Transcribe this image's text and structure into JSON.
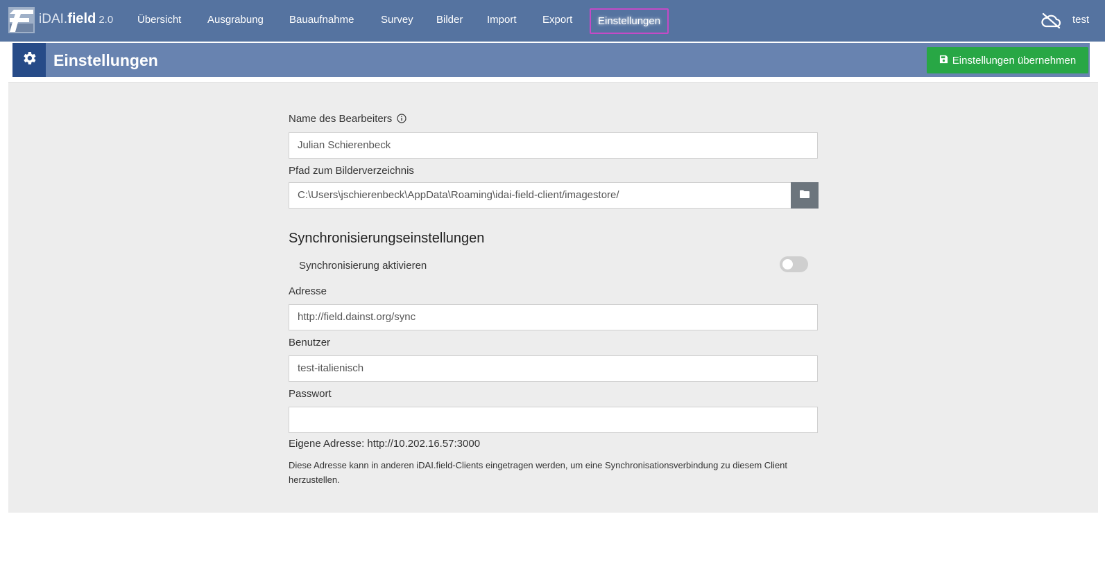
{
  "app": {
    "brand_light": "iDAI.",
    "brand_bold": "field",
    "version": "2.0"
  },
  "nav": {
    "items": [
      {
        "label": "Übersicht"
      },
      {
        "label": "Ausgrabung"
      },
      {
        "label": "Bauaufnahme"
      },
      {
        "label": "Survey"
      },
      {
        "label": "Bilder"
      },
      {
        "label": "Import"
      },
      {
        "label": "Export"
      },
      {
        "label": "Einstellungen",
        "active": true
      }
    ],
    "user": "test",
    "sync_status_icon": "cloud-off-icon"
  },
  "header": {
    "title": "Einstellungen",
    "icon": "gear-icon",
    "save_label": "Einstellungen übernehmen"
  },
  "form": {
    "editor_name_label": "Name des Bearbeiters",
    "editor_name_value": "Julian Schierenbeck",
    "image_path_label": "Pfad zum Bilderverzeichnis",
    "image_path_value": "C:\\Users\\jschierenbeck\\AppData\\Roaming\\idai-field-client/imagestore/",
    "sync_heading": "Synchronisierungseinstellungen",
    "sync_toggle_label": "Synchronisierung aktivieren",
    "sync_enabled": false,
    "address_label": "Adresse",
    "address_value": "http://field.dainst.org/sync",
    "user_label": "Benutzer",
    "user_value": "test-italienisch",
    "password_label": "Passwort",
    "password_value": "",
    "own_address": "Eigene Adresse: http://10.202.16.57:3000",
    "help_text": "Diese Adresse kann in anderen iDAI.field-Clients eingetragen werden, um eine Synchronisationsverbindung zu diesem Client herzustellen."
  },
  "colors": {
    "navbar": "#5573a0",
    "header": "#6883b0",
    "header_icon_bg": "#274b88",
    "save_button": "#28a745",
    "active_outline": "#c44ac7"
  }
}
